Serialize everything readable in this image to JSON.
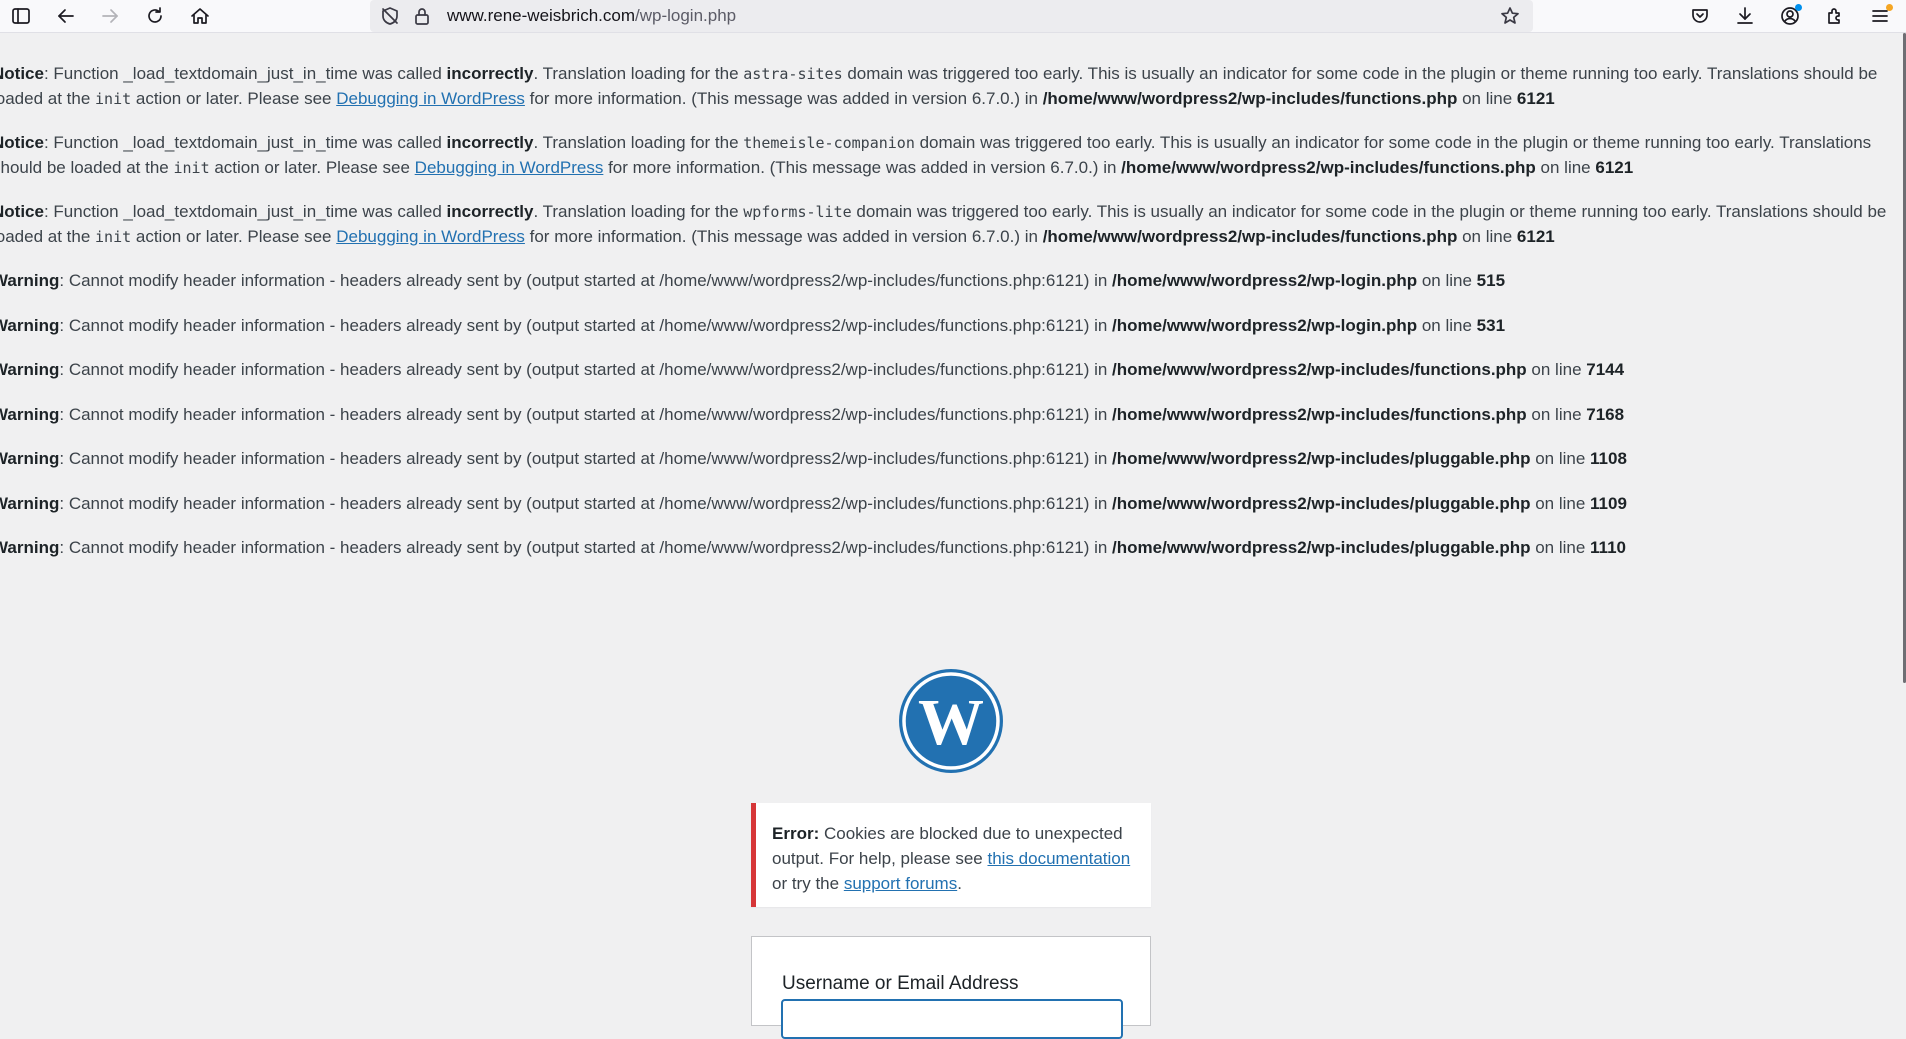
{
  "browser": {
    "url_domain": "www.rene-weisbrich.com",
    "url_path": "/wp-login.php",
    "icons": [
      "sidebar-icon",
      "back-icon",
      "forward-icon",
      "reload-icon",
      "home-icon",
      "tracking-protection-icon",
      "lock-icon",
      "bookmark-star-icon",
      "pocket-icon",
      "downloads-icon",
      "account-icon",
      "extensions-icon",
      "menu-icon"
    ]
  },
  "notices": [
    {
      "label": "Notice",
      "p1": ": Function _load_textdomain_just_in_time was called ",
      "strong": "incorrectly",
      "p2": ". Translation loading for the ",
      "domain": "astra-sites",
      "p3": " domain was triggered too early. This is usually an indicator for some code in the plugin or theme running too early. Translations should be loaded at the ",
      "init": "init",
      "p4": " action or later. Please see ",
      "link": "Debugging in WordPress",
      "p5": " for more information. (This message was added in version 6.7.0.) in ",
      "file": "/home/www/wordpress2/wp-includes/functions.php",
      "p6": " on line ",
      "line": "6121"
    },
    {
      "label": "Notice",
      "p1": ": Function _load_textdomain_just_in_time was called ",
      "strong": "incorrectly",
      "p2": ". Translation loading for the ",
      "domain": "themeisle-companion",
      "p3": " domain was triggered too early. This is usually an indicator for some code in the plugin or theme running too early. Translations should be loaded at the ",
      "init": "init",
      "p4": " action or later. Please see ",
      "link": "Debugging in WordPress",
      "p5": " for more information. (This message was added in version 6.7.0.) in ",
      "file": "/home/www/wordpress2/wp-includes/functions.php",
      "p6": " on line ",
      "line": "6121"
    },
    {
      "label": "Notice",
      "p1": ": Function _load_textdomain_just_in_time was called ",
      "strong": "incorrectly",
      "p2": ". Translation loading for the ",
      "domain": "wpforms-lite",
      "p3": " domain was triggered too early. This is usually an indicator for some code in the plugin or theme running too early. Translations should be loaded at the ",
      "init": "init",
      "p4": " action or later. Please see ",
      "link": "Debugging in WordPress",
      "p5": " for more information. (This message was added in version 6.7.0.) in ",
      "file": "/home/www/wordpress2/wp-includes/functions.php",
      "p6": " on line ",
      "line": "6121"
    }
  ],
  "warnings": [
    {
      "label": "Warning",
      "text": ": Cannot modify header information - headers already sent by (output started at /home/www/wordpress2/wp-includes/functions.php:6121) in ",
      "file": "/home/www/wordpress2/wp-login.php",
      "on": " on line ",
      "line": "515"
    },
    {
      "label": "Warning",
      "text": ": Cannot modify header information - headers already sent by (output started at /home/www/wordpress2/wp-includes/functions.php:6121) in ",
      "file": "/home/www/wordpress2/wp-login.php",
      "on": " on line ",
      "line": "531"
    },
    {
      "label": "Warning",
      "text": ": Cannot modify header information - headers already sent by (output started at /home/www/wordpress2/wp-includes/functions.php:6121) in ",
      "file": "/home/www/wordpress2/wp-includes/functions.php",
      "on": " on line ",
      "line": "7144"
    },
    {
      "label": "Warning",
      "text": ": Cannot modify header information - headers already sent by (output started at /home/www/wordpress2/wp-includes/functions.php:6121) in ",
      "file": "/home/www/wordpress2/wp-includes/functions.php",
      "on": " on line ",
      "line": "7168"
    },
    {
      "label": "Warning",
      "text": ": Cannot modify header information - headers already sent by (output started at /home/www/wordpress2/wp-includes/functions.php:6121) in ",
      "file": "/home/www/wordpress2/wp-includes/pluggable.php",
      "on": " on line ",
      "line": "1108"
    },
    {
      "label": "Warning",
      "text": ": Cannot modify header information - headers already sent by (output started at /home/www/wordpress2/wp-includes/functions.php:6121) in ",
      "file": "/home/www/wordpress2/wp-includes/pluggable.php",
      "on": " on line ",
      "line": "1109"
    },
    {
      "label": "Warning",
      "text": ": Cannot modify header information - headers already sent by (output started at /home/www/wordpress2/wp-includes/functions.php:6121) in ",
      "file": "/home/www/wordpress2/wp-includes/pluggable.php",
      "on": " on line ",
      "line": "1110"
    }
  ],
  "login": {
    "logo_icon": "wordpress-logo",
    "error": {
      "label": "Error:",
      "t1": " Cookies are blocked due to unexpected output. For help, please see ",
      "link1": "this documentation",
      "t2": " or try the ",
      "link2": "support forums",
      "t3": "."
    },
    "username_label": "Username or Email Address",
    "username_value": ""
  },
  "colors": {
    "background": "#f0f0f1",
    "link": "#2271b1",
    "error_border": "#d63638",
    "wp_blue": "#2271b1"
  }
}
